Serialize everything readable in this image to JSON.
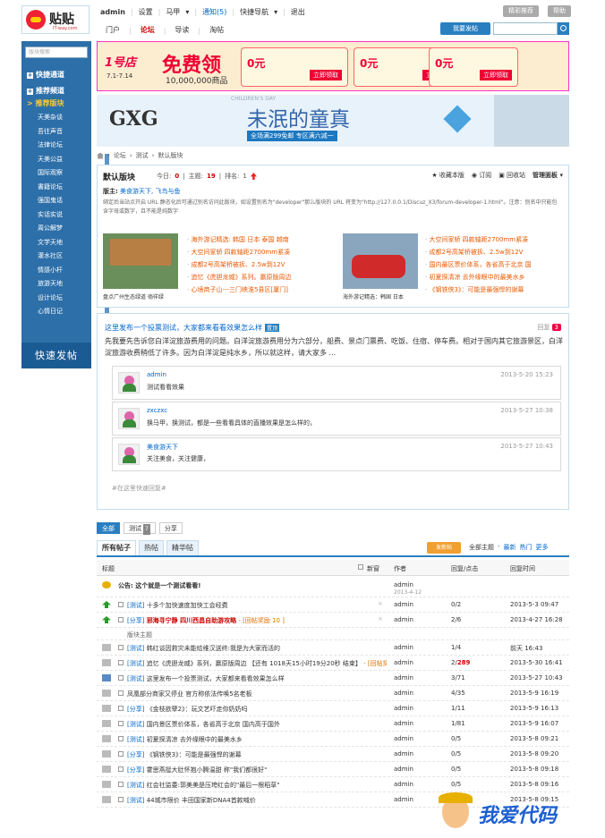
{
  "logo": {
    "text": "贴贴",
    "sub": "IT-way.com"
  },
  "userbar": {
    "username": "admin",
    "settings": "设置",
    "majia": "马甲",
    "notice": "通知(5)",
    "quicknav": "快捷导航",
    "logout": "退出",
    "btn_recommend": "精彩推荐",
    "btn_help": "帮助"
  },
  "nav": {
    "items": [
      "门户",
      "论坛",
      "导读",
      "淘帖"
    ],
    "active": 1,
    "post_btn": "我要发帖"
  },
  "sidebar": {
    "search_placeholder": "版块搜索",
    "head1": "快捷通道",
    "head2": "推荐频道",
    "active": "> 推荐版块",
    "items": [
      "天美杂谈",
      "吾往声音",
      "法律论坛",
      "天美公益",
      "国际观察",
      "書籍论坛",
      "强国鬼话",
      "实话实说",
      "周公解梦",
      "文学天地",
      "灌水社区",
      "情感小杆",
      "旅游天地",
      "设计论坛",
      "心情日记"
    ],
    "fast_post": "快速发帖"
  },
  "banner1": {
    "brand": "1号店",
    "dates": "7.1-7.14",
    "headline": "免费领",
    "sub": "10,000,000商品",
    "coupons": [
      {
        "value": "0元",
        "btn": "立即领取"
      },
      {
        "value": "0元",
        "btn": "立即领取"
      },
      {
        "value": "0元",
        "btn": "立即领取"
      }
    ]
  },
  "banner2": {
    "brand": "GXG",
    "day": "CHILDREN'S DAY",
    "title": "未泯的童真",
    "tag": "全场满299免邮 专区满六减一"
  },
  "breadcrumb": [
    "论坛",
    "测试",
    "默认版块"
  ],
  "board": {
    "title": "默认版块",
    "today_label": "今日:",
    "today": "0",
    "topics_label": "主题:",
    "topics": "19",
    "rank_label": "排名:",
    "rank": "1",
    "actions": [
      "收藏本版",
      "订阅",
      "回收站",
      "管理面板"
    ],
    "moderators_label": "版主:",
    "moderators": "美食游天下, 飞鸟与鱼",
    "desc": "绑定后当站点开启 URL 静态化后可通过别名访问此版块，如设置别名为\"developer\"那么版块的 URL 将变为\"http://127.0.0.1/Discuz_X3/forum-developer-1.html\"。注意：别名中只能包含字母或数字，且不能是纯数字",
    "thumb1_caption": "盘点广州生态绿道 徜徉绿",
    "thumb2_caption": "海外游记精选：韩国 日本",
    "links1": [
      "海外游记精选: 韩国 日本 泰国 越南",
      "大空间家轿 四款轴距2700mm紧凑",
      "成都2号高架桥被拆、2.5w到12V",
      "追忆《虎胆龙威》系列。赢原版周边",
      "心境商子山---三门峡淮5县区[厦门]"
    ],
    "links2": [
      "大空间家轿 四款轴距2700mm紧凑",
      "成都2号高架桥被拆、2.5w到12V",
      "国内最区票价体系，各省高于北京 国",
      "初夏探清凉 去外缘眼中的最美水乡",
      "《钢铁侠3》：可能是最强悍的谢幕"
    ]
  },
  "poll": {
    "title": "这里发布一个投票测试，大家都来看看效果怎么样",
    "badge": "置顶",
    "reply_label": "回复",
    "reply_count": "3",
    "desc": "先我要先告诉您白洋淀旅游费用的问题。白洋淀旅游费用分为六部分，船费、景点门票费、吃饭、住宿、停车费。相对于国内其它旅游景区，白洋淀旅游收费稍低了许多。因为白洋淀是纯水乡，所以就这样，请大家多 ...",
    "comments": [
      {
        "user": "admin",
        "text": "测试看看效果",
        "time": "2013-5-20 15:23"
      },
      {
        "user": "zxczxc",
        "text": "换马甲，换测试，都是一些看看具体的直播效果是怎么样的，",
        "time": "2013-5-27 10:38"
      },
      {
        "user": "美食游天下",
        "text": "关注美食，关注健康，",
        "time": "2013-5-27 10:43"
      }
    ],
    "quick": "#在这里快速回复#"
  },
  "filters": [
    {
      "label": "全部"
    },
    {
      "label": "测试",
      "count": "7"
    },
    {
      "label": "分享"
    }
  ],
  "tabs": [
    "所有帖子",
    "热帖",
    "精华帖"
  ],
  "list": {
    "new_btn": "发新帖",
    "sorts": [
      "全部主题",
      "最新",
      "热门",
      "更多"
    ],
    "headers": {
      "title": "标题",
      "newwin": "新窗",
      "author": "作者",
      "reply": "回复/点击",
      "last": "回复时间"
    },
    "section_label": "版块主题",
    "rows": [
      {
        "type": "ann",
        "title": "公告: 这个就是一个测试看看!",
        "author": "admin",
        "date": "2013-4-12"
      },
      {
        "type": "up",
        "cat": "[测试]",
        "title": "十多个加快速度加快工会经费",
        "author": "admin",
        "reply": "0/2",
        "last": "2013-5-3 09:47",
        "x": true
      },
      {
        "type": "up",
        "cat": "[分享]",
        "title": "邪海寻宁静 四川西昌自助游攻略",
        "tag": "- [回帖奖励 10 ]",
        "red": true,
        "author": "admin",
        "reply": "2/6",
        "last": "2013-4-27 16:28",
        "x": true
      },
      {
        "type": "section"
      },
      {
        "type": "norm",
        "cat": "[测试]",
        "title": "韩红谈因救灾未能给维汉送终:我是为大家而活的",
        "author": "admin",
        "reply": "1/4",
        "last": "前天 16:43"
      },
      {
        "type": "norm",
        "cat": "[测试]",
        "title": "追忆《虎胆龙威》系列，赢原版周边 【还有 1018天15小时19分20秒 结束】",
        "tag": "- [回帖奖励 1 ]",
        "author": "admin",
        "reply": "2/289",
        "reply_red": true,
        "last": "2013-5-30 16:41"
      },
      {
        "type": "poll",
        "cat": "[测试]",
        "title": "这里发布一个投票测试，大家都来看看效果怎么样",
        "author": "admin",
        "reply": "3/71",
        "last": "2013-5-27 10:43"
      },
      {
        "type": "norm",
        "title": "凤凰部分商家又停业 官方称依法传唤5名老板",
        "author": "admin",
        "reply": "4/35",
        "last": "2013-5-9 16:19"
      },
      {
        "type": "norm",
        "cat": "[分享]",
        "title": "《金枝欲孽2》：玩文艺吓走你奶奶吗",
        "author": "admin",
        "reply": "1/11",
        "last": "2013-5-9 16:13"
      },
      {
        "type": "norm",
        "cat": "[测试]",
        "title": "国内景区票价体系，各省高于北京 国内高于国外",
        "author": "admin",
        "reply": "1/81",
        "last": "2013-5-9 16:07"
      },
      {
        "type": "norm",
        "cat": "[测试]",
        "title": "初夏探清凉 去外缘眼中的最美水乡",
        "author": "admin",
        "reply": "0/5",
        "last": "2013-5-8 09:21"
      },
      {
        "type": "norm",
        "cat": "[分享]",
        "title": "《钢铁侠3》：可能是最强悍的谢幕",
        "author": "admin",
        "reply": "0/5",
        "last": "2013-5-8 09:20"
      },
      {
        "type": "norm",
        "cat": "[分享]",
        "title": "霍思燕挺大肚怀抱小腾温甜 称\"我们都很好\"",
        "author": "admin",
        "reply": "0/5",
        "last": "2013-5-8 09:18"
      },
      {
        "type": "norm",
        "cat": "[测试]",
        "title": "红会社监委:郭美美是压垮红会的\"最后一根稻草\"",
        "author": "admin",
        "reply": "0/5",
        "last": "2013-5-8 09:16"
      },
      {
        "type": "norm",
        "cat": "[测试]",
        "title": "44城市限价 丰田国家新DNA4首款喊价",
        "author": "admin",
        "reply": "0/5",
        "last": "2013-5-8 09:15"
      }
    ]
  },
  "watermark": "我爱代码",
  "colors": {
    "brand": "#2a7fc0",
    "sidebar": "#2d6fa9",
    "accent": "#c00"
  }
}
